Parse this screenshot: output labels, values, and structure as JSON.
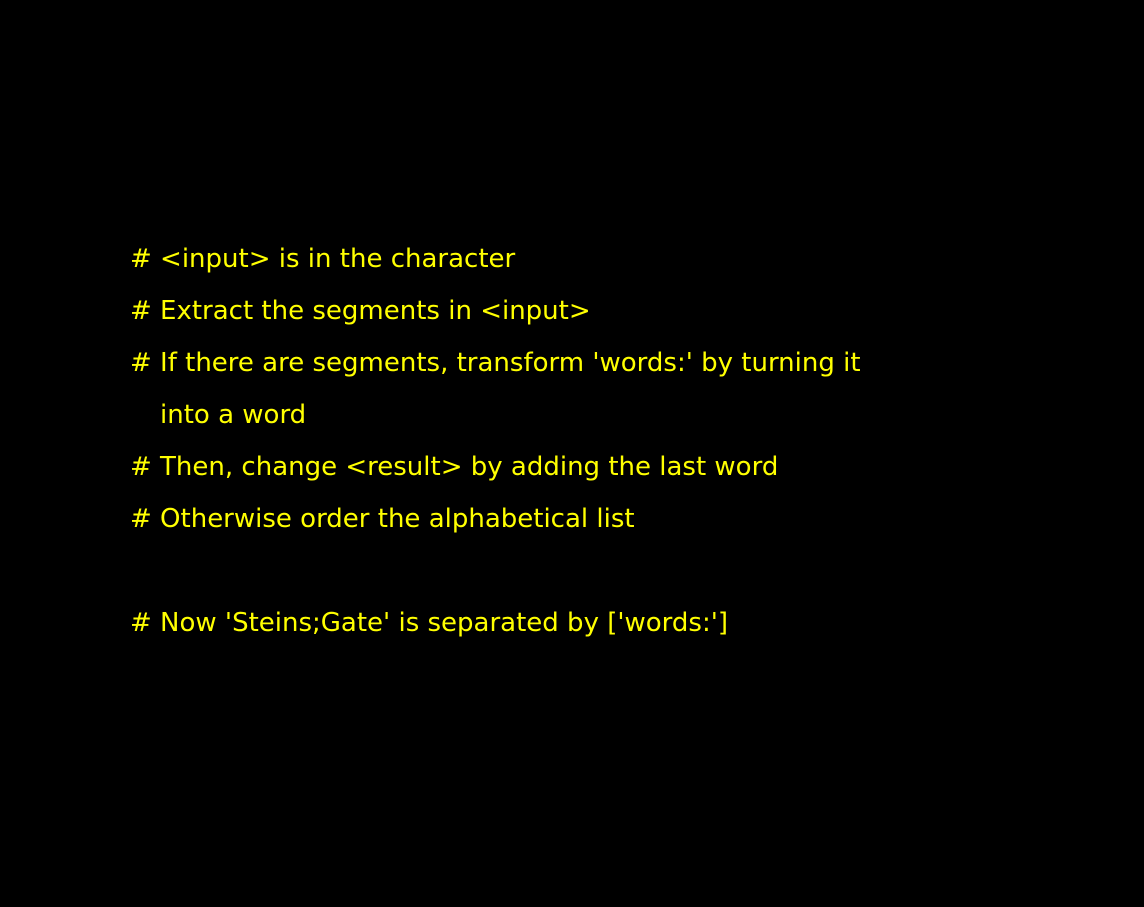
{
  "colors": {
    "background": "#000000",
    "text": "#ffff00"
  },
  "comment_lines": [
    "# <input> is in the character",
    "# Extract the segments in <input>",
    "# If there are segments, transform 'words:' by turning it",
    "into a word",
    "# Then, change <result> by adding the last word",
    "# Otherwise order the alphabetical list",
    "",
    "# Now 'Steins;Gate' is separated by ['words:']"
  ]
}
